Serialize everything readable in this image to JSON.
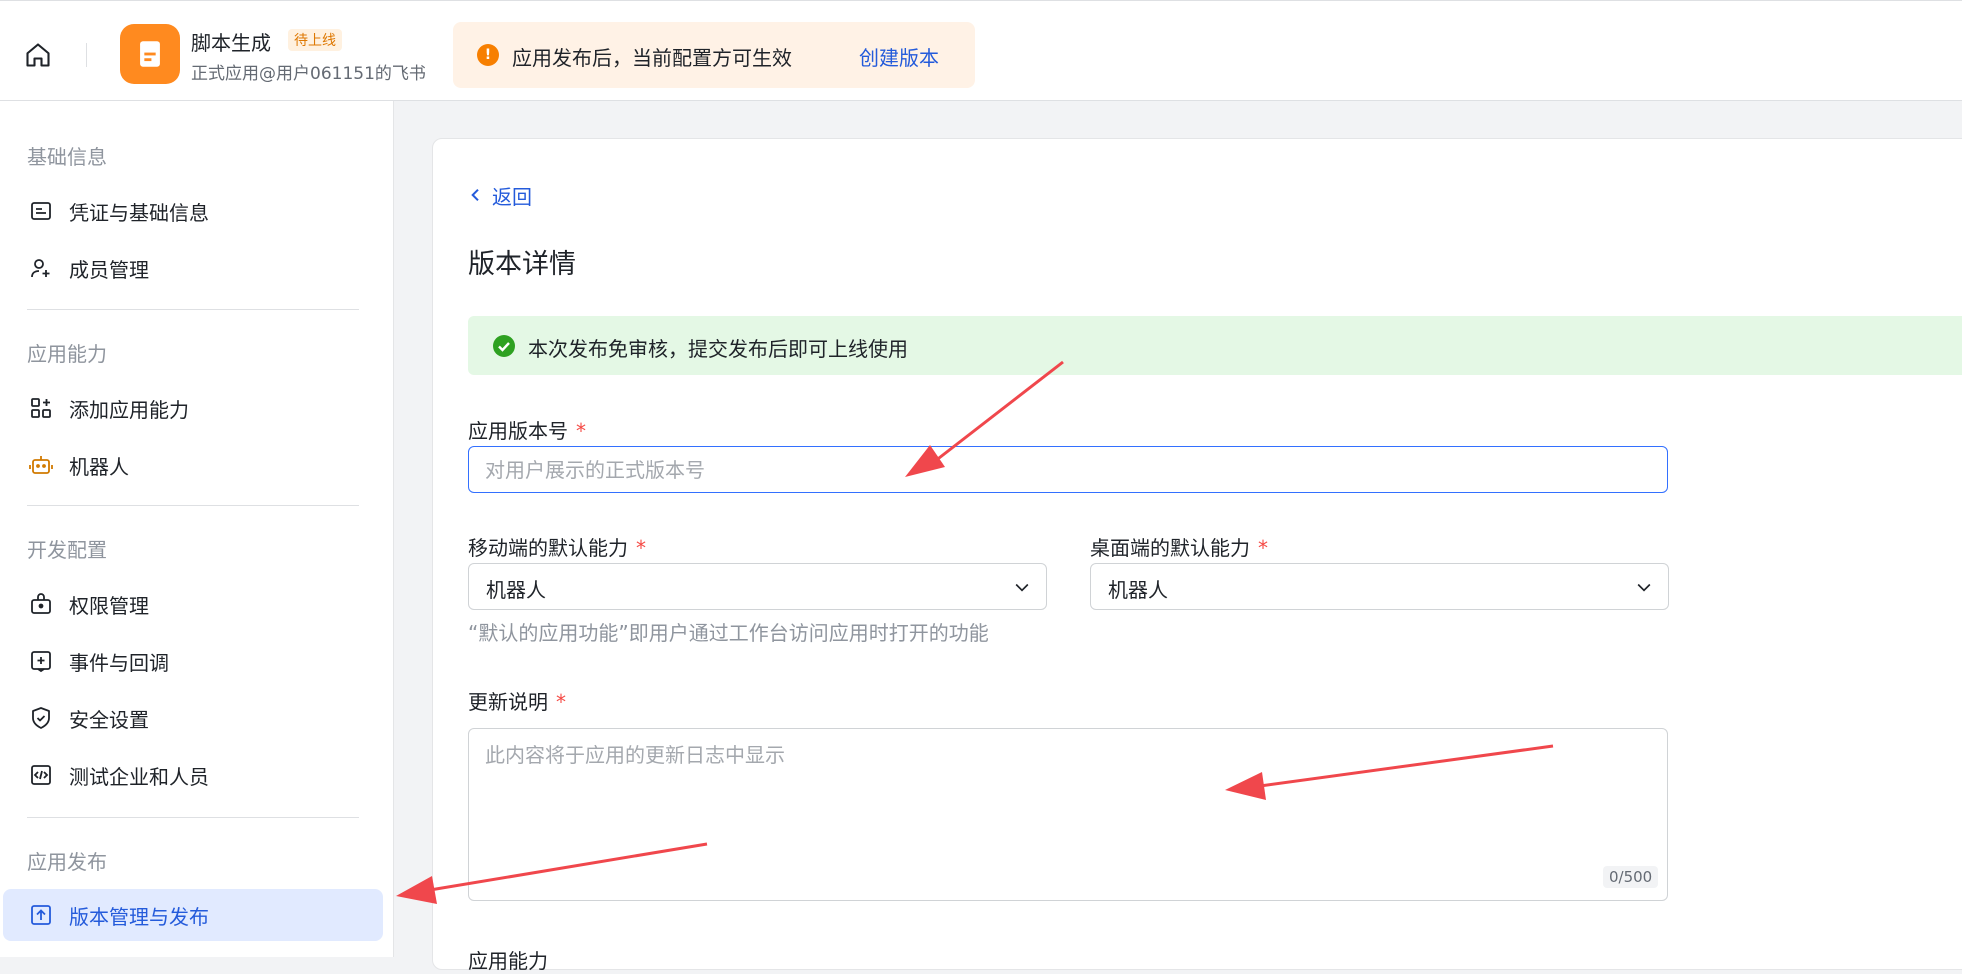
{
  "header": {
    "app_name": "脚本生成",
    "app_status": "待上线",
    "app_subtitle": "正式应用@用户061151的飞书",
    "notice_text": "应用发布后，当前配置方可生效",
    "notice_link": "创建版本"
  },
  "sidebar": {
    "sections": [
      {
        "title": "基础信息",
        "items": [
          {
            "label": "凭证与基础信息",
            "icon": "credential-icon"
          },
          {
            "label": "成员管理",
            "icon": "member-icon"
          }
        ]
      },
      {
        "title": "应用能力",
        "items": [
          {
            "label": "添加应用能力",
            "icon": "grid-add-icon"
          },
          {
            "label": "机器人",
            "icon": "robot-icon"
          }
        ]
      },
      {
        "title": "开发配置",
        "items": [
          {
            "label": "权限管理",
            "icon": "lock-bag-icon"
          },
          {
            "label": "事件与回调",
            "icon": "event-icon"
          },
          {
            "label": "安全设置",
            "icon": "shield-icon"
          },
          {
            "label": "测试企业和人员",
            "icon": "code-icon"
          }
        ]
      },
      {
        "title": "应用发布",
        "items": [
          {
            "label": "版本管理与发布",
            "icon": "upload-icon",
            "active": true
          }
        ]
      }
    ]
  },
  "main": {
    "back_label": "返回",
    "page_title": "版本详情",
    "success_text": "本次发布免审核，提交发布后即可上线使用",
    "version_label": "应用版本号",
    "version_placeholder": "对用户展示的正式版本号",
    "mobile_label": "移动端的默认能力",
    "mobile_value": "机器人",
    "desktop_label": "桌面端的默认能力",
    "desktop_value": "机器人",
    "hint": "“默认的应用功能”即用户通过工作台访问应用时打开的功能",
    "update_label": "更新说明",
    "update_placeholder": "此内容将于应用的更新日志中显示",
    "counter": "0/500",
    "next_label": "应用能力"
  },
  "colors": {
    "accent": "#245bdb",
    "required": "#f54a45",
    "success": "#2ea121",
    "warning": "#f77f00",
    "annotation_arrow": "#f0474c"
  }
}
